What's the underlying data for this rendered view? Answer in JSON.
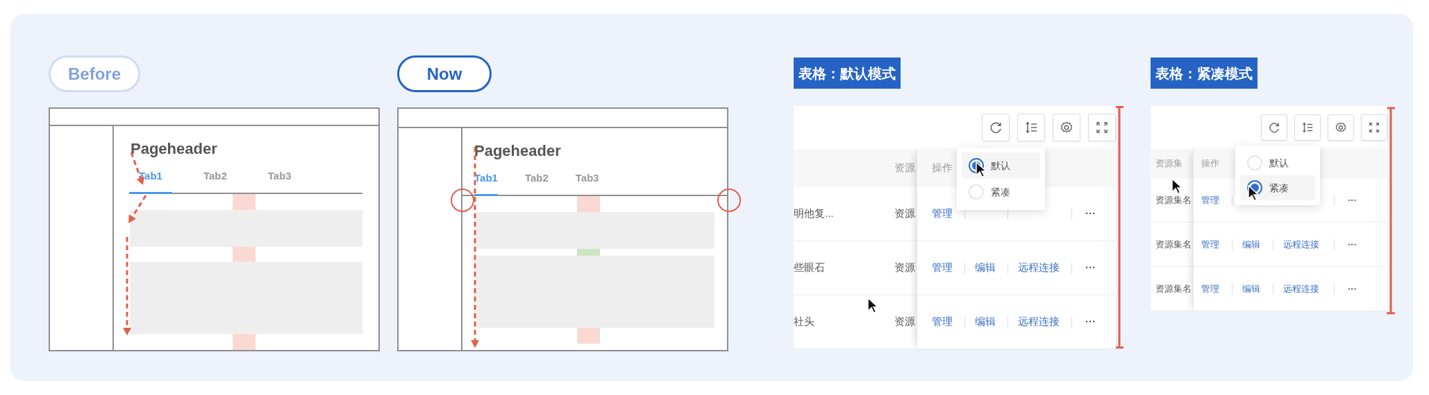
{
  "comparisons": [
    {
      "label": "Before",
      "active": false,
      "wireframe": {
        "title": "Pageheader",
        "sticky_tabs": false,
        "tabs": [
          {
            "label": "Tab1",
            "selected": true
          },
          {
            "label": "Tab2",
            "selected": false
          },
          {
            "label": "Tab3",
            "selected": false
          }
        ],
        "spacers": [
          {
            "ok": false
          },
          {
            "ok": false
          },
          {
            "ok": false
          }
        ]
      }
    },
    {
      "label": "Now",
      "active": true,
      "wireframe": {
        "title": "Pageheader",
        "sticky_tabs": true,
        "tabs": [
          {
            "label": "Tab1",
            "selected": true
          },
          {
            "label": "Tab2",
            "selected": false
          },
          {
            "label": "Tab3",
            "selected": false
          }
        ],
        "spacers": [
          {
            "ok": false
          },
          {
            "ok": true
          },
          {
            "ok": false
          }
        ]
      }
    }
  ],
  "tables": [
    {
      "title": "表格：默认模式",
      "kind": "default",
      "header": {
        "resource": "资源",
        "actions": "操作"
      },
      "density_menu": [
        {
          "label": "默认",
          "selected": true
        },
        {
          "label": "紧凑",
          "selected": false
        }
      ],
      "rows": [
        {
          "name": "明他复...",
          "resource": "资源",
          "actions": [
            "管理"
          ],
          "more": "···"
        },
        {
          "name": "些眼石",
          "resource": "资源",
          "actions": [
            "管理",
            "编辑",
            "远程连接"
          ],
          "more": "···"
        },
        {
          "name": "社头",
          "resource": "资源",
          "actions": [
            "管理",
            "编辑",
            "远程连接"
          ],
          "more": "···"
        }
      ]
    },
    {
      "title": "表格：紧凑模式",
      "kind": "compact",
      "header": {
        "resource": "资源集",
        "actions": "操作"
      },
      "density_menu": [
        {
          "label": "默认",
          "selected": false
        },
        {
          "label": "紧凑",
          "selected": true
        }
      ],
      "rows": [
        {
          "resource": "资源集名",
          "actions": [
            "管理"
          ],
          "more": "···"
        },
        {
          "resource": "资源集名",
          "actions": [
            "管理",
            "编辑",
            "远程连接"
          ],
          "more": "···"
        },
        {
          "resource": "资源集名",
          "actions": [
            "管理",
            "编辑",
            "远程连接"
          ],
          "more": "···"
        }
      ]
    }
  ]
}
